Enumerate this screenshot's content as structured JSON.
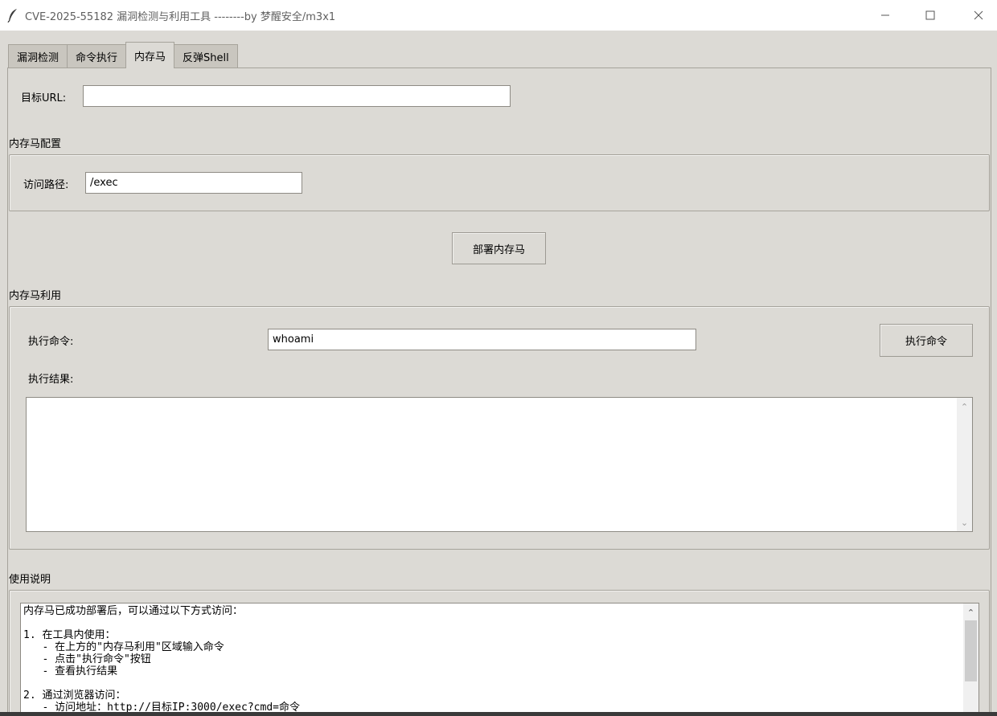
{
  "window": {
    "title": "CVE-2025-55182 漏洞检测与利用工具 --------by 梦醒安全/m3x1",
    "icon": "feather-icon"
  },
  "tabs": [
    {
      "label": "漏洞检测"
    },
    {
      "label": "命令执行"
    },
    {
      "label": "内存马"
    },
    {
      "label": "反弹Shell"
    }
  ],
  "target": {
    "label": "目标URL:",
    "value": ""
  },
  "config": {
    "section_label": "内存马配置",
    "path_label": "访问路径:",
    "path_value": "/exec"
  },
  "deploy_button": "部署内存马",
  "exploit": {
    "section_label": "内存马利用",
    "command_label": "执行命令:",
    "command_value": "whoami",
    "exec_button": "执行命令",
    "result_label": "执行结果:",
    "result_text": ""
  },
  "usage": {
    "section_label": "使用说明",
    "text": "内存马已成功部署后，可以通过以下方式访问：\n\n1. 在工具内使用：\n   - 在上方的\"内存马利用\"区域输入命令\n   - 点击\"执行命令\"按钮\n   - 查看执行结果\n\n2. 通过浏览器访问：\n   - 访问地址：http://目标IP:3000/exec?cmd=命令"
  },
  "colors": {
    "background": "#dcdad5",
    "field": "#ffffff",
    "border": "#a6a39b"
  }
}
